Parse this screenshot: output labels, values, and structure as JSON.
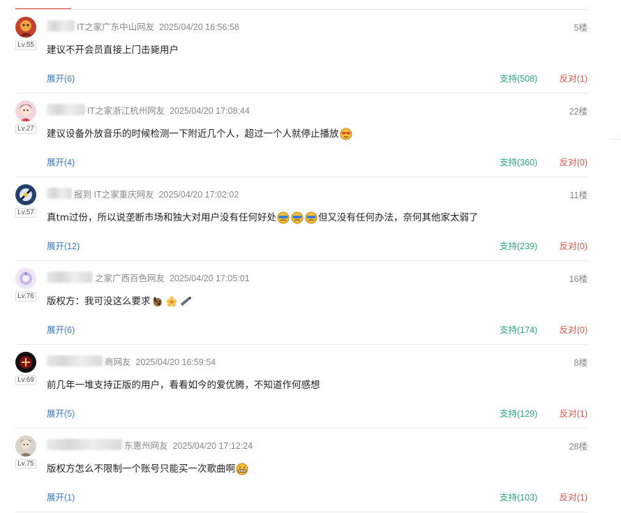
{
  "comments": [
    {
      "level": "Lv.55",
      "location": "IT之家广东中山网友",
      "time": "2025/04/20 16:56:58",
      "floor": "5楼",
      "content": "建议不开会员直接上门击毙用户",
      "expand": "展开(6)",
      "support": "支持(508)",
      "oppose": "反对(1)"
    },
    {
      "level": "Lv.27",
      "location": "IT之家浙江杭州网友",
      "time": "2025/04/20 17:08:44",
      "floor": "22楼",
      "content": "建议设备外放音乐的时候检测一下附近几个人，超过一个人就停止播放",
      "expand": "展开(4)",
      "support": "支持(360)",
      "oppose": "反对(0)"
    },
    {
      "level": "Lv.57",
      "location": "报到  IT之家重庆网友",
      "time": "2025/04/20 17:02:02",
      "floor": "11楼",
      "content_a": "真tm过份，所以说垄断市场和独大对用户没有任何好处",
      "content_b": "但又没有任何办法，奈何其他家太弱了",
      "expand": "展开(12)",
      "support": "支持(239)",
      "oppose": "反对(0)"
    },
    {
      "level": "Lv.76",
      "location": "之家广西百色网友",
      "time": "2025/04/20 17:05:01",
      "floor": "16楼",
      "content": "版权方：我可没这么要求",
      "expand": "展开(6)",
      "support": "支持(174)",
      "oppose": "反对(0)"
    },
    {
      "level": "Lv.69",
      "location": "商网友",
      "time": "2025/04/20 16:59:54",
      "floor": "8楼",
      "content": "前几年一堆支持正版的用户，看看如今的爱优腾，不知道作何感想",
      "expand": "展开(5)",
      "support": "支持(129)",
      "oppose": "反对(1)"
    },
    {
      "level": "Lv.75",
      "location": "东惠州网友",
      "time": "2025/04/20 17:12:24",
      "floor": "28楼",
      "content": "版权方怎么不限制一个账号只能买一次歌曲啊",
      "expand": "展开(1)",
      "support": "支持(103)",
      "oppose": "反对(1)"
    }
  ]
}
